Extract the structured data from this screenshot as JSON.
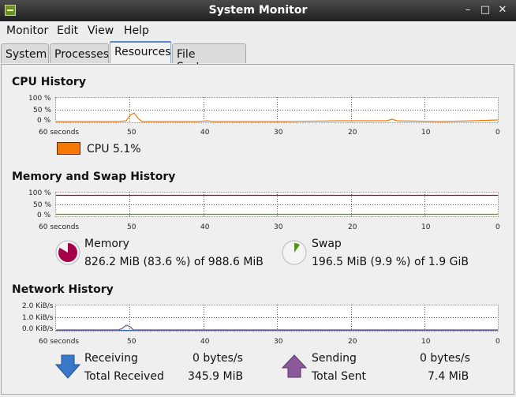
{
  "window": {
    "title": "System Monitor"
  },
  "menu": [
    "Monitor",
    "Edit",
    "View",
    "Help"
  ],
  "tabs": [
    "System",
    "Processes",
    "Resources",
    "File Systems"
  ],
  "active_tab": "Resources",
  "x_axis_labels": [
    "60 seconds",
    "50",
    "40",
    "30",
    "20",
    "10",
    "0"
  ],
  "cpu": {
    "title": "CPU History",
    "y_labels": [
      "100 %",
      "50 %",
      "0 %"
    ],
    "legend_label": "CPU",
    "legend_value": "5.1%",
    "color": "#f57900"
  },
  "memory": {
    "title": "Memory and Swap History",
    "y_labels": [
      "100 %",
      "50 %",
      "0 %"
    ],
    "mem_label": "Memory",
    "mem_value": "826.2 MiB (83.6 %) of 988.6 MiB",
    "mem_fraction": 0.836,
    "mem_color": "#a40048",
    "swap_label": "Swap",
    "swap_value": "196.5 MiB (9.9 %) of 1.9 GiB",
    "swap_fraction": 0.099,
    "swap_color": "#4e9a06"
  },
  "network": {
    "title": "Network History",
    "y_labels": [
      "2.0 KiB/s",
      "1.0 KiB/s",
      "0.0 KiB/s"
    ],
    "receiving_label": "Receiving",
    "receiving_value": "0 bytes/s",
    "total_received_label": "Total Received",
    "total_received_value": "345.9 MiB",
    "sending_label": "Sending",
    "sending_value": "0 bytes/s",
    "total_sent_label": "Total Sent",
    "total_sent_value": "7.4 MiB",
    "receive_color": "#3465a4",
    "send_color": "#75507b"
  }
}
